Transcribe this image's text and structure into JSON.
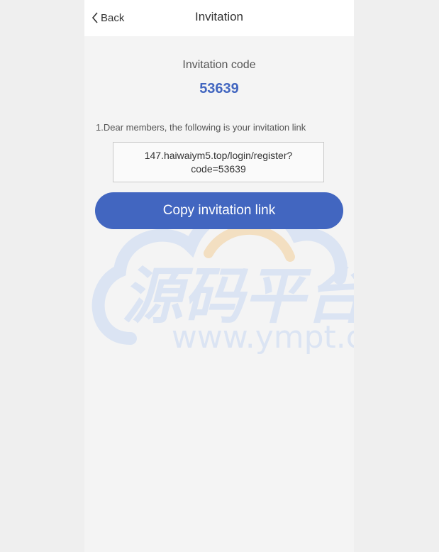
{
  "header": {
    "back_label": "Back",
    "title": "Invitation"
  },
  "invitation": {
    "code_label": "Invitation code",
    "code_value": "53639",
    "description": "1.Dear members, the following is your invitation link",
    "link": "147.haiwaiym5.top/login/register?code=53639",
    "copy_button_label": "Copy invitation link"
  },
  "watermark": {
    "chinese_text": "源码平台",
    "url_text": "www.ympt.cc"
  },
  "colors": {
    "accent": "#4266c0",
    "header_bg": "#ffffff",
    "page_bg": "#f4f4f4",
    "outer_bg": "#efefef"
  },
  "icons": {
    "back": "chevron-left-icon"
  }
}
